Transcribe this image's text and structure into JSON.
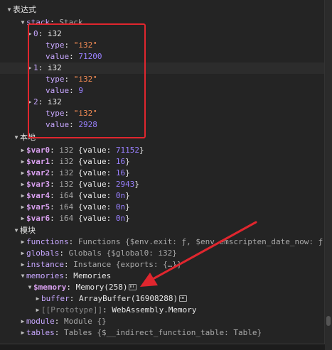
{
  "scope": {
    "expressions_label": "表达式",
    "local_label": "本地",
    "module_label": "模块"
  },
  "stack": {
    "key": "stack",
    "type": "Stack",
    "items": [
      {
        "index": "0",
        "kind": "i32",
        "type_value": "\"i32\"",
        "value": "71200"
      },
      {
        "index": "1",
        "kind": "i32",
        "type_value": "\"i32\"",
        "value": "9"
      },
      {
        "index": "2",
        "kind": "i32",
        "type_value": "\"i32\"",
        "value": "2928"
      }
    ]
  },
  "locals": [
    {
      "name": "$var0",
      "kind": "i32",
      "value": "71152"
    },
    {
      "name": "$var1",
      "kind": "i32",
      "value": "16"
    },
    {
      "name": "$var2",
      "kind": "i32",
      "value": "16"
    },
    {
      "name": "$var3",
      "kind": "i32",
      "value": "2943"
    },
    {
      "name": "$var4",
      "kind": "i64",
      "value": "0n"
    },
    {
      "name": "$var5",
      "kind": "i64",
      "value": "0n"
    },
    {
      "name": "$var6",
      "kind": "i64",
      "value": "0n"
    }
  ],
  "module": {
    "functions": {
      "key": "functions",
      "text": "Functions {$env.exit: ƒ, $env.emscripten_date_now: ƒ,"
    },
    "globals": {
      "key": "globals",
      "text": "Globals {$global0: i32}"
    },
    "instance": {
      "key": "instance",
      "text": "Instance {exports: {…}}"
    },
    "memories": {
      "key": "memories",
      "text": "Memories"
    },
    "memory": {
      "key": "$memory",
      "text": "Memory(258)"
    },
    "buffer": {
      "key": "buffer",
      "text": "ArrayBuffer(16908288)"
    },
    "prototype": {
      "key": "[[Prototype]]",
      "text": "WebAssembly.Memory"
    },
    "module_item": {
      "key": "module",
      "text": "Module {}"
    },
    "tables": {
      "key": "tables",
      "text": "Tables {$__indirect_function_table: Table}"
    }
  },
  "labels": {
    "type_key": "type",
    "value_key": "value",
    "value_prefix": "{value: ",
    "value_suffix": "}"
  },
  "colors": {
    "annotation_red": "#e0262e",
    "string": "#f28b54",
    "number": "#9980ff"
  },
  "icons": [
    "triangle-down-icon",
    "triangle-right-icon",
    "memory-inspector-icon",
    "annotation-arrow"
  ]
}
